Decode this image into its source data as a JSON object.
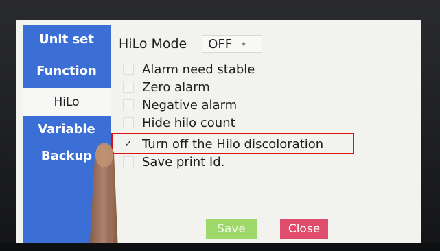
{
  "sidebar": {
    "tabs": [
      {
        "label": "Unit set",
        "active": false
      },
      {
        "label": "Function",
        "active": false
      },
      {
        "label": "HiLo",
        "active": true
      },
      {
        "label": "Variable",
        "active": false
      },
      {
        "label": "Backup",
        "active": false
      }
    ]
  },
  "hilo_mode": {
    "label": "HiLo Mode",
    "value": "OFF"
  },
  "options": [
    {
      "label": "Alarm need stable",
      "checked": false
    },
    {
      "label": "Zero alarm",
      "checked": false
    },
    {
      "label": "Negative alarm",
      "checked": false
    },
    {
      "label": "Hide hilo count",
      "checked": false
    },
    {
      "label": "Turn off the Hilo discoloration",
      "checked": true
    },
    {
      "label": "Save print Id.",
      "checked": false
    }
  ],
  "buttons": {
    "save_label": "Save",
    "close_label": "Close"
  },
  "colors": {
    "sidebar": "#3b6fd6",
    "save": "#9fd86a",
    "close": "#e04d6c",
    "highlight": "#e01010"
  },
  "icons": {
    "check": "check-icon",
    "dropdown": "chevron-down-icon"
  }
}
